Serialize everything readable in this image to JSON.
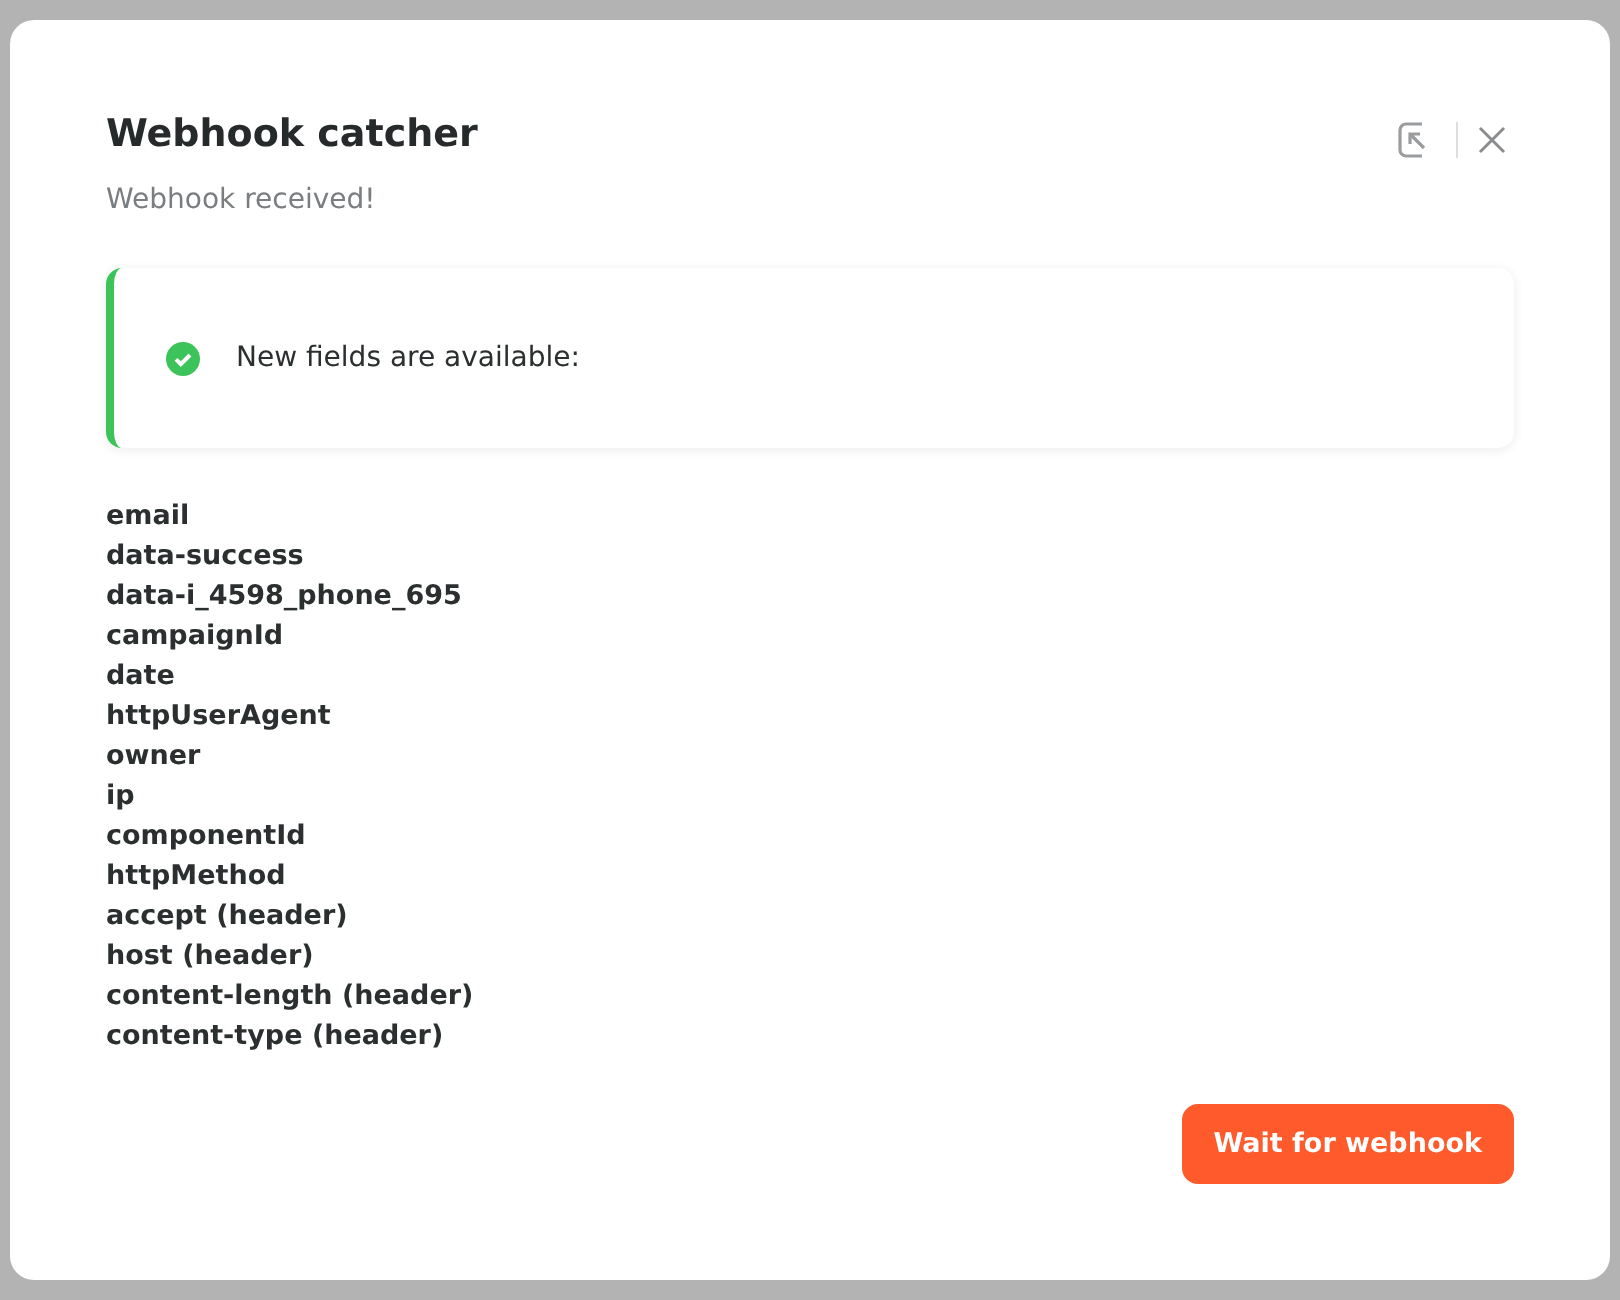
{
  "dialog": {
    "title": "Webhook catcher",
    "subtitle": "Webhook received!"
  },
  "alert": {
    "kind": "success",
    "message": "New fields are available:"
  },
  "fields": [
    "email",
    "data-success",
    "data-i_4598_phone_695",
    "campaignId",
    "date",
    "httpUserAgent",
    "owner",
    "ip",
    "componentId",
    "httpMethod",
    "accept (header)",
    "host (header)",
    "content-length (header)",
    "content-type (header)"
  ],
  "buttons": [
    {
      "label": "Wait for webhook"
    }
  ]
}
